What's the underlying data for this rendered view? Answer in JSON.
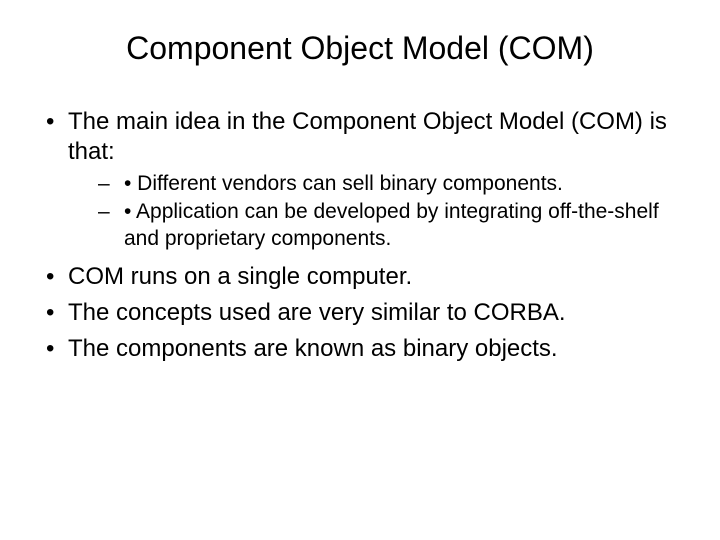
{
  "title": "Component Object Model (COM)",
  "bullets": {
    "b1": "The main idea in the Component Object Model (COM) is that:",
    "b1_sub1": "• Different vendors can sell binary components.",
    "b1_sub2": "• Application can be developed by integrating off-the-shelf and proprietary components.",
    "b2": "COM runs on a single computer.",
    "b3": "The concepts used are very similar to CORBA.",
    "b4": "The components are known as binary objects."
  }
}
